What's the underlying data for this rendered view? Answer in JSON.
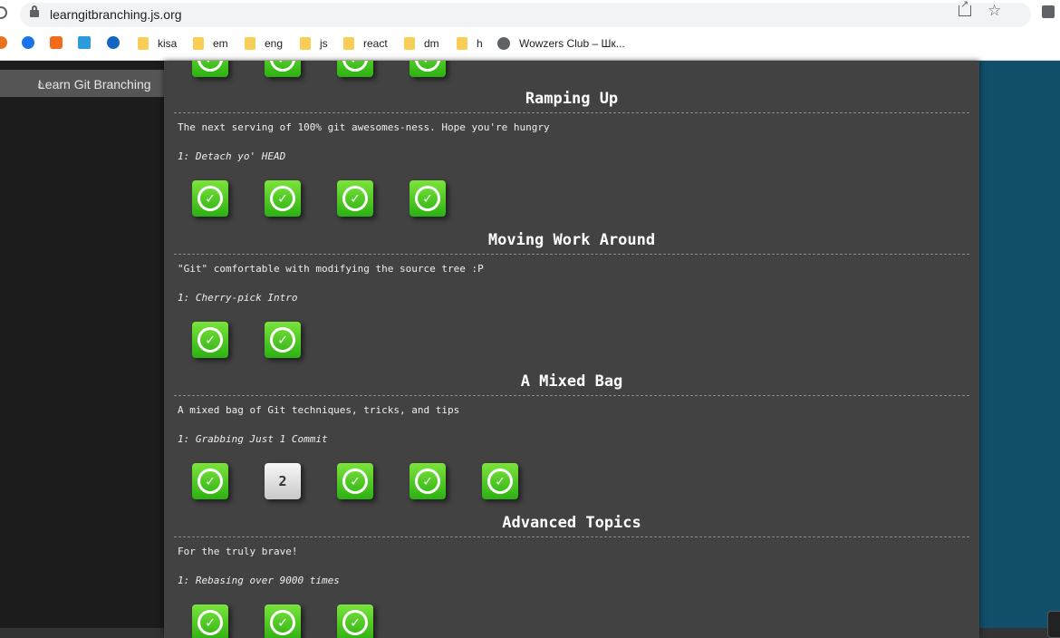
{
  "browser": {
    "url": "learngitbranching.js.org",
    "bookmarks": [
      "kisa",
      "em",
      "eng",
      "js",
      "react",
      "dm",
      "h",
      "Wowzers Club – Шк..."
    ]
  },
  "sidebar": {
    "tab_label": "Learn Git Branching"
  },
  "sections": [
    {
      "title": "Ramping Up",
      "description": "The next serving of 100% git awesomes-ness. Hope you're hungry",
      "current_level": "1: Detach yo' HEAD",
      "levels": [
        "done",
        "done",
        "done",
        "done"
      ]
    },
    {
      "title": "Moving Work Around",
      "description": "\"Git\" comfortable with modifying the source tree :P",
      "current_level": "1: Cherry-pick Intro",
      "levels": [
        "done",
        "done"
      ]
    },
    {
      "title": "A Mixed Bag",
      "description": "A mixed bag of Git techniques, tricks, and tips",
      "current_level": "1: Grabbing Just 1 Commit",
      "levels": [
        "done",
        "2",
        "done",
        "done",
        "done"
      ]
    },
    {
      "title": "Advanced Topics",
      "description": "For the truly brave!",
      "current_level": "1: Rebasing over 9000 times",
      "levels": [
        "done",
        "done",
        "done"
      ]
    }
  ],
  "colors": {
    "done_badge": "#3cc31c",
    "pending_badge": "#e0e0e0",
    "panel": "#424242",
    "page_bg": "#114f6b"
  }
}
